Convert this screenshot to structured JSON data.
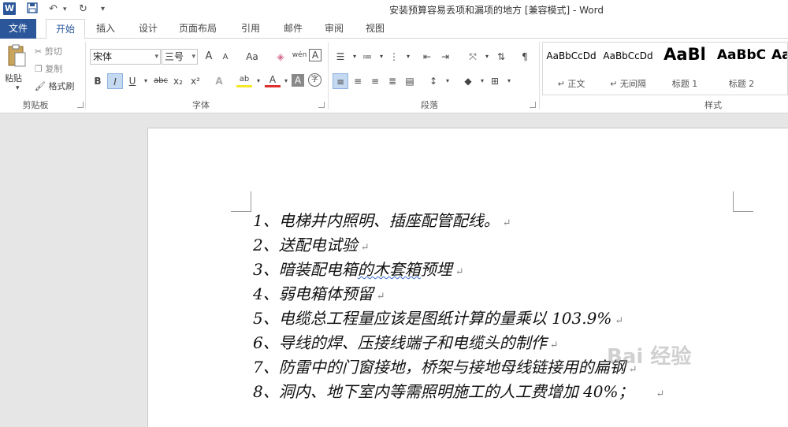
{
  "window": {
    "title": "安装预算容易丢项和漏项的地方 [兼容模式] - Word",
    "app_icon": "W"
  },
  "qat": {
    "save_icon": "save-icon",
    "undo_icon": "undo-icon",
    "redo_icon": "redo-icon",
    "customize_icon": "customize-qat-icon"
  },
  "tabs": [
    "文件",
    "开始",
    "插入",
    "设计",
    "页面布局",
    "引用",
    "邮件",
    "审阅",
    "视图"
  ],
  "ribbon": {
    "clipboard": {
      "paste": "粘贴",
      "cut": "剪切",
      "copy": "复制",
      "format_painter": "格式刷",
      "label": "剪贴板"
    },
    "font": {
      "font_name": "宋体",
      "font_size": "三号",
      "label": "字体",
      "grow": "A",
      "shrink": "A",
      "change_case": "Aa",
      "bold": "B",
      "italic": "I",
      "underline": "U",
      "strike": "abc",
      "sub": "x₂",
      "sup": "x²",
      "text_effect": "A",
      "highlight": "ab",
      "font_color": "A",
      "char_shading": "A",
      "enclose": "字",
      "phonetic": "wén",
      "border_char": "A"
    },
    "paragraph": {
      "label": "段落"
    },
    "styles": {
      "label": "样式",
      "items": [
        {
          "sample": "AaBbCcDd",
          "name": "↵ 正文"
        },
        {
          "sample": "AaBbCcDd",
          "name": "↵ 无间隔"
        },
        {
          "sample": "AaBl",
          "name": "标题 1"
        },
        {
          "sample": "AaBbC",
          "name": "标题 2"
        },
        {
          "sample": "Aa",
          "name": ""
        }
      ]
    }
  },
  "document": {
    "lines": [
      "1、电梯井内照明、插座配管配线。",
      "2、送配电试验",
      "3、暗装配电箱",
      "4、弱电箱体预留",
      "5、电缆总工程量应该是图纸计算的量乘以 103.9%",
      "6、导线的焊、压接线端子和电缆头的制作",
      "7、防雷中的门窗接地，桥架与接地母线链接用的扁钢",
      "8、洞内、地下室内等需照明施工的人工费增加 40%；"
    ],
    "line3_underlined": "的木套箱",
    "line3_tail": "预埋",
    "paragraph_mark": "↵",
    "watermark": "Bai 经验"
  }
}
